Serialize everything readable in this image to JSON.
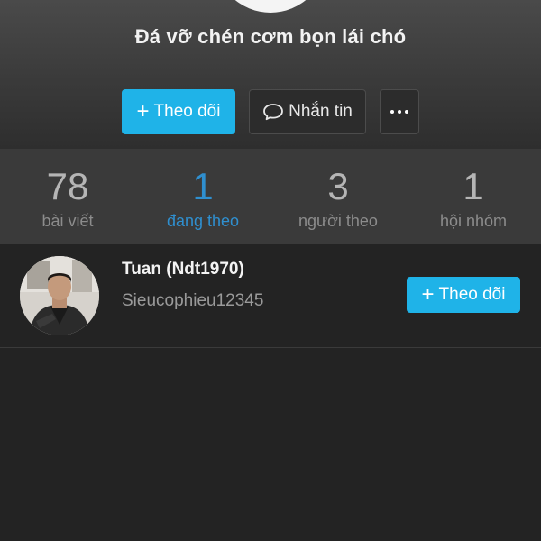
{
  "profile": {
    "name": "Đá vỡ chén cơm bọn lái chó"
  },
  "actions": {
    "follow_label": "Theo dõi",
    "message_label": "Nhắn tin"
  },
  "stats": [
    {
      "count": "78",
      "label": "bài viết"
    },
    {
      "count": "1",
      "label": "đang theo"
    },
    {
      "count": "3",
      "label": "người theo"
    },
    {
      "count": "1",
      "label": "hội nhóm"
    }
  ],
  "active_stat": "đang theo",
  "following": [
    {
      "name": "Tuan (Ndt1970)",
      "handle": "Sieucophieu12345",
      "follow_label": "Theo dõi"
    }
  ],
  "icons": {
    "follow": "plus-icon",
    "message": "chat-bubble-icon",
    "more": "more-dots-icon"
  },
  "colors": {
    "accent": "#1fb3e8",
    "active_tab": "#2f8fcf",
    "background": "#232323"
  }
}
